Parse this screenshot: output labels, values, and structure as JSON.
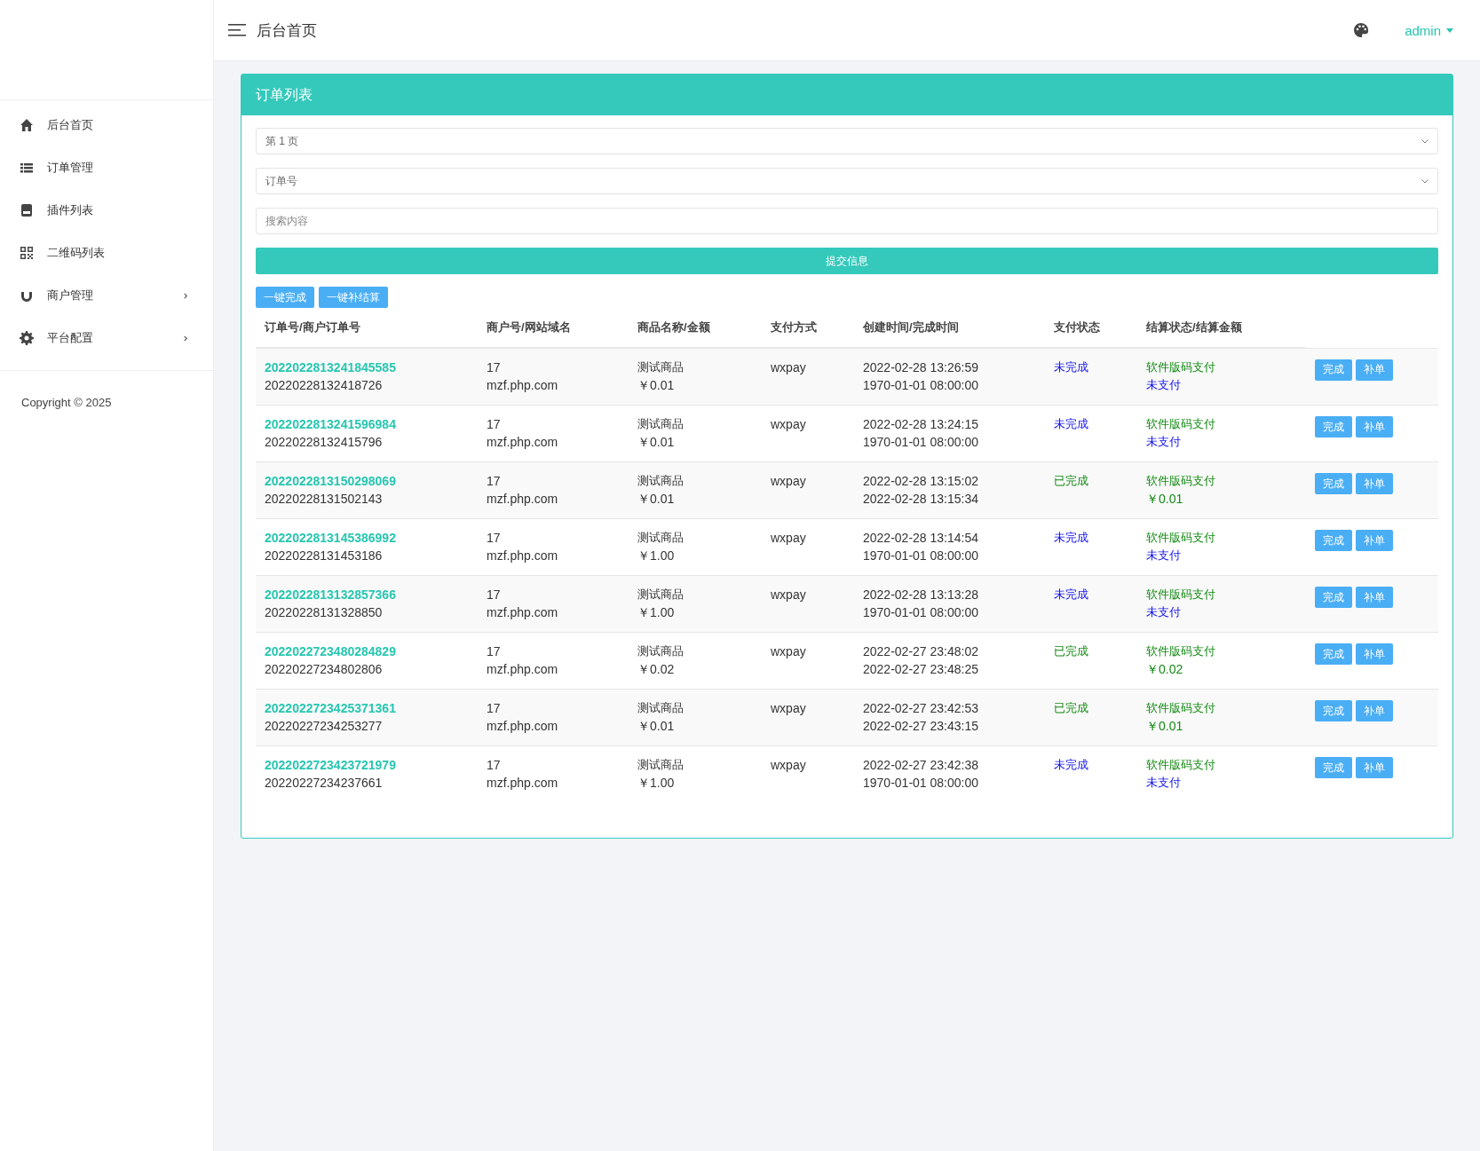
{
  "sidebar": {
    "items": [
      {
        "label": "后台首页",
        "kind": "home",
        "has_submenu": false
      },
      {
        "label": "订单管理",
        "kind": "list",
        "has_submenu": false
      },
      {
        "label": "插件列表",
        "kind": "plugin",
        "has_submenu": false
      },
      {
        "label": "二维码列表",
        "kind": "qrcode",
        "has_submenu": false
      },
      {
        "label": "商户管理",
        "kind": "magnet",
        "has_submenu": true
      },
      {
        "label": "平台配置",
        "kind": "gear",
        "has_submenu": true
      }
    ],
    "copyright": "Copyright © 2025"
  },
  "header": {
    "title": "后台首页",
    "user": "admin"
  },
  "panel": {
    "title": "订单列表",
    "page_select": {
      "value": "第 1 页"
    },
    "field_select": {
      "value": "订单号"
    },
    "search": {
      "placeholder": "搜索内容"
    },
    "submit": "提交信息",
    "bulk_buttons": [
      "一键完成",
      "一键补结算"
    ],
    "table": {
      "columns": [
        "订单号/商户订单号",
        "商户号/网站域名",
        "商品名称/金额",
        "支付方式",
        "创建时间/完成时间",
        "支付状态",
        "结算状态/结算金额"
      ],
      "rows": [
        {
          "order_no": "2022022813241845585",
          "merchant_order_no": "20220228132418726",
          "merchant_id": "17",
          "domain": "mzf.php.com",
          "product": "测试商品",
          "amount": "￥0.01",
          "method": "wxpay",
          "created": "2022-02-28 13:26:59",
          "finished": "1970-01-01 08:00:00",
          "pay_status": "未完成",
          "paid": false,
          "settle_type": "软件版码支付",
          "settle_value": "未支付",
          "settled": false,
          "actions": [
            "完成",
            "补单"
          ]
        },
        {
          "order_no": "2022022813241596984",
          "merchant_order_no": "20220228132415796",
          "merchant_id": "17",
          "domain": "mzf.php.com",
          "product": "测试商品",
          "amount": "￥0.01",
          "method": "wxpay",
          "created": "2022-02-28 13:24:15",
          "finished": "1970-01-01 08:00:00",
          "pay_status": "未完成",
          "paid": false,
          "settle_type": "软件版码支付",
          "settle_value": "未支付",
          "settled": false,
          "actions": [
            "完成",
            "补单"
          ]
        },
        {
          "order_no": "2022022813150298069",
          "merchant_order_no": "20220228131502143",
          "merchant_id": "17",
          "domain": "mzf.php.com",
          "product": "测试商品",
          "amount": "￥0.01",
          "method": "wxpay",
          "created": "2022-02-28 13:15:02",
          "finished": "2022-02-28 13:15:34",
          "pay_status": "已完成",
          "paid": true,
          "settle_type": "软件版码支付",
          "settle_value": "￥0.01",
          "settled": true,
          "actions": [
            "完成",
            "补单"
          ]
        },
        {
          "order_no": "2022022813145386992",
          "merchant_order_no": "20220228131453186",
          "merchant_id": "17",
          "domain": "mzf.php.com",
          "product": "测试商品",
          "amount": "￥1.00",
          "method": "wxpay",
          "created": "2022-02-28 13:14:54",
          "finished": "1970-01-01 08:00:00",
          "pay_status": "未完成",
          "paid": false,
          "settle_type": "软件版码支付",
          "settle_value": "未支付",
          "settled": false,
          "actions": [
            "完成",
            "补单"
          ]
        },
        {
          "order_no": "2022022813132857366",
          "merchant_order_no": "20220228131328850",
          "merchant_id": "17",
          "domain": "mzf.php.com",
          "product": "测试商品",
          "amount": "￥1.00",
          "method": "wxpay",
          "created": "2022-02-28 13:13:28",
          "finished": "1970-01-01 08:00:00",
          "pay_status": "未完成",
          "paid": false,
          "settle_type": "软件版码支付",
          "settle_value": "未支付",
          "settled": false,
          "actions": [
            "完成",
            "补单"
          ]
        },
        {
          "order_no": "2022022723480284829",
          "merchant_order_no": "20220227234802806",
          "merchant_id": "17",
          "domain": "mzf.php.com",
          "product": "测试商品",
          "amount": "￥0.02",
          "method": "wxpay",
          "created": "2022-02-27 23:48:02",
          "finished": "2022-02-27 23:48:25",
          "pay_status": "已完成",
          "paid": true,
          "settle_type": "软件版码支付",
          "settle_value": "￥0.02",
          "settled": true,
          "actions": [
            "完成",
            "补单"
          ]
        },
        {
          "order_no": "2022022723425371361",
          "merchant_order_no": "20220227234253277",
          "merchant_id": "17",
          "domain": "mzf.php.com",
          "product": "测试商品",
          "amount": "￥0.01",
          "method": "wxpay",
          "created": "2022-02-27 23:42:53",
          "finished": "2022-02-27 23:43:15",
          "pay_status": "已完成",
          "paid": true,
          "settle_type": "软件版码支付",
          "settle_value": "￥0.01",
          "settled": true,
          "actions": [
            "完成",
            "补单"
          ]
        },
        {
          "order_no": "2022022723423721979",
          "merchant_order_no": "20220227234237661",
          "merchant_id": "17",
          "domain": "mzf.php.com",
          "product": "测试商品",
          "amount": "￥1.00",
          "method": "wxpay",
          "created": "2022-02-27 23:42:38",
          "finished": "1970-01-01 08:00:00",
          "pay_status": "未完成",
          "paid": false,
          "settle_type": "软件版码支付",
          "settle_value": "未支付",
          "settled": false,
          "actions": [
            "完成",
            "补单"
          ]
        }
      ]
    }
  }
}
